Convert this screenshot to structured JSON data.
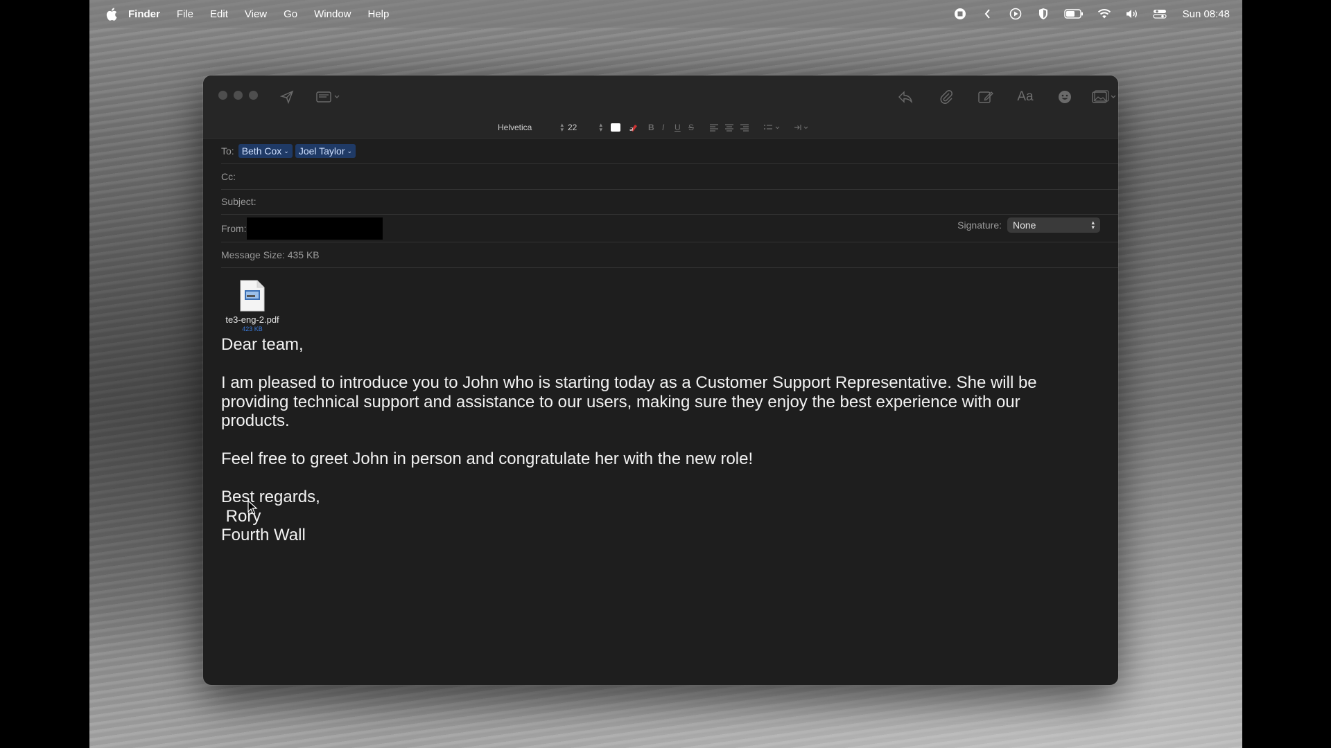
{
  "menubar": {
    "app_name": "Finder",
    "items": [
      "File",
      "Edit",
      "View",
      "Go",
      "Window",
      "Help"
    ],
    "status_icons": [
      "screen-record-icon",
      "chevron-left-icon",
      "play-icon",
      "shield-icon",
      "battery-icon",
      "wifi-icon",
      "volume-icon",
      "control-center-icon"
    ],
    "clock": "Sun  08:48"
  },
  "format_bar": {
    "font": "Helvetica",
    "size": "22",
    "text_color": "#ffffff"
  },
  "compose": {
    "to_label": "To:",
    "recipients": [
      "Beth Cox",
      "Joel Taylor"
    ],
    "cc_label": "Cc:",
    "subject_label": "Subject:",
    "subject_value": "",
    "from_label": "From:",
    "signature_label": "Signature:",
    "signature_value": "None",
    "message_size": "Message Size: 435 KB"
  },
  "attachment": {
    "filename": "te3-eng-2.pdf",
    "size": "423 KB",
    "type_label": "PDF"
  },
  "message": {
    "greeting": "Dear team,",
    "paragraph1": "I am pleased to introduce you to John who is starting today as a Customer Support Representative. She will be providing technical support and assistance to our users, making sure they enjoy the best experience with our products.",
    "paragraph2": "Feel free to greet John in person and congratulate her with the new role!",
    "closing": "Best regards,",
    "name": " Rory",
    "company": "Fourth Wall"
  },
  "colors": {
    "window_bg": "#1e1e1e",
    "token_bg": "#1f3a66",
    "accent_blue": "#3b7ad9"
  }
}
